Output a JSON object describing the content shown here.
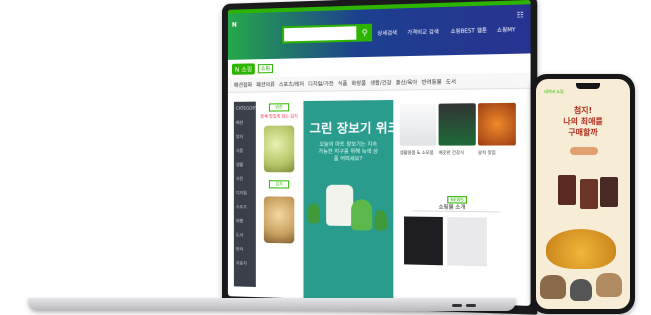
{
  "browser": {
    "logo": "N",
    "header_links": [
      "쇼핑BEST",
      "웹툰",
      "로그인",
      "쇼핑MY"
    ],
    "search_options": [
      "상세검색",
      "가격비교 검색"
    ],
    "grid_icon": "grid-icon"
  },
  "shop": {
    "logo": "N 쇼핑",
    "tag": "쇼핑",
    "categories": [
      "패션잡화",
      "패션의류",
      "스포츠/레저",
      "디지털/가전",
      "가구/인테리어",
      "식품",
      "화장품",
      "생활/건강",
      "출산/육아",
      "여가/여행",
      "반려동물",
      "도서",
      "키즈",
      "명품",
      "럭셔리"
    ],
    "sidebar_title": "CATEGORY",
    "sidebar_items": [
      "패션",
      "뷰티",
      "식품",
      "생활",
      "가전",
      "디지털",
      "스포츠",
      "여행",
      "도서",
      "반려",
      "자동차",
      "키즈"
    ]
  },
  "banner": {
    "title": "그린 장보기 위크",
    "subtitle": "오늘의 마트 장보기는 지속가능한 지구를 위해 녹색 상품 어떠세요?",
    "left_badge": "반찬",
    "left_text": "함께 맛있게 담는 김치",
    "badge2": "김치"
  },
  "products": {
    "row1_titles": [
      "생활용품 & 소모품",
      "깨끗한 건강식",
      "갈치 맛집"
    ],
    "news_badge": "NEWS",
    "news_title": "쇼핑몰 소개"
  },
  "phone": {
    "brand": "네이버 쇼핑",
    "title_line1": "첨지!",
    "title_line2": "나의 최애를",
    "title_line3": "구매할까",
    "button": "구매하기"
  },
  "colors": {
    "naver_green": "#2db400",
    "header_navy": "#283391",
    "banner_teal": "#2a9c8e",
    "phone_bg": "#f7ecd5",
    "phone_title": "#b0301f"
  }
}
